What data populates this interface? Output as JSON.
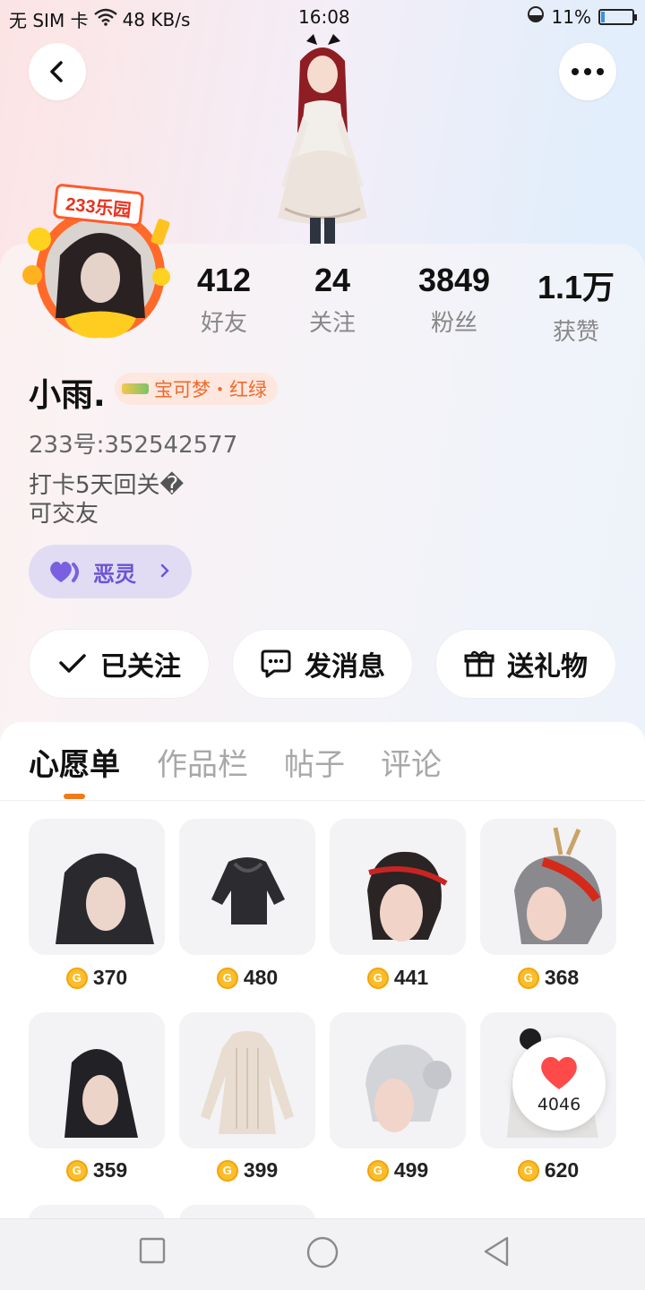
{
  "status_bar": {
    "carrier": "无 SIM 卡",
    "net_speed": "48 KB/s",
    "time": "16:08",
    "battery": "11%",
    "battery_level": 0.11
  },
  "profile": {
    "stats": [
      {
        "value": "412",
        "label": "好友"
      },
      {
        "value": "24",
        "label": "关注"
      },
      {
        "value": "3849",
        "label": "粉丝"
      },
      {
        "value": "1.1万",
        "label": "获赞"
      }
    ],
    "avatar_frame_text": "233乐园",
    "username": "小雨.",
    "badge": "宝可梦・红绿",
    "uid": "233号:352542577",
    "bio_line1": "打卡5天回关�",
    "bio_line2": "可交友",
    "mood_label": "恶灵"
  },
  "actions": {
    "follow": "已关注",
    "message": "发消息",
    "gift": "送礼物"
  },
  "tabs": [
    "心愿单",
    "作品栏",
    "帖子",
    "评论"
  ],
  "wishlist": [
    {
      "name": "black-wavy-hair",
      "price": "370"
    },
    {
      "name": "black-hoodie",
      "price": "480"
    },
    {
      "name": "red-ribbon-ponytail-hair",
      "price": "441"
    },
    {
      "name": "feather-red-grey-hair",
      "price": "368"
    },
    {
      "name": "black-straight-hair",
      "price": "359"
    },
    {
      "name": "knit-sweater-dress",
      "price": "399"
    },
    {
      "name": "silver-bun-hair",
      "price": "499"
    },
    {
      "name": "panda-hat-hair",
      "price": "620"
    }
  ],
  "like_count": "4046",
  "colors": {
    "accent": "#f07a1a",
    "coin": "#fbbd2a",
    "mood": "#6b54d6",
    "heart": "#ff4a4a"
  }
}
